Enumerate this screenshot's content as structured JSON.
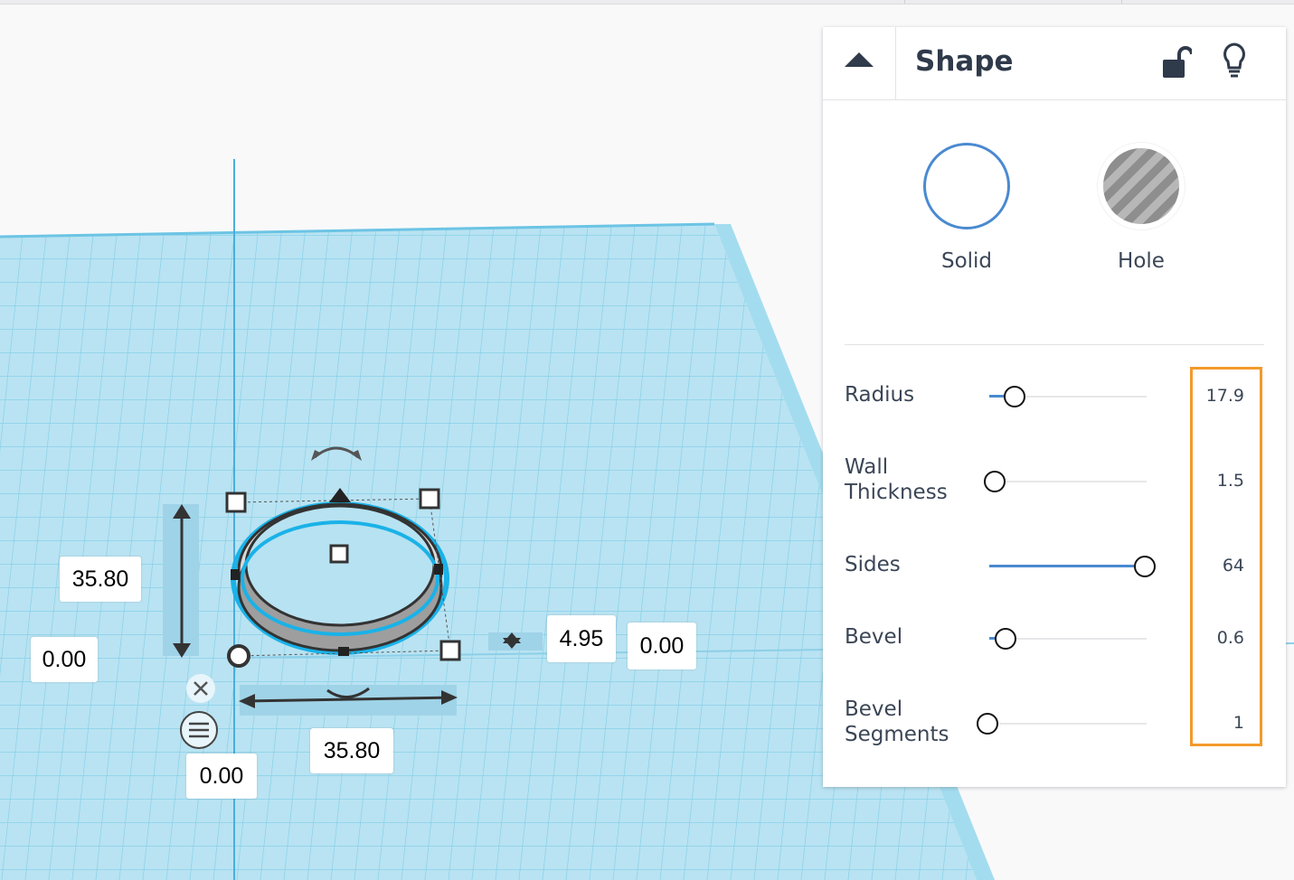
{
  "inspector": {
    "title": "Shape",
    "icons": [
      "collapse-up-icon",
      "lock-open-icon",
      "lightbulb-icon"
    ],
    "types": [
      {
        "label": "Solid",
        "selected": true
      },
      {
        "label": "Hole",
        "selected": false
      }
    ],
    "params": [
      {
        "label": "Radius",
        "value": "17.9",
        "slider_fraction": 0.18
      },
      {
        "label": "Wall\nThickness",
        "value": "1.5",
        "slider_fraction": 0.0
      },
      {
        "label": "Sides",
        "value": "64",
        "slider_fraction": 1.0
      },
      {
        "label": "Bevel",
        "value": "0.6",
        "slider_fraction": 0.12
      },
      {
        "label": "Bevel\nSegments",
        "value": "1",
        "slider_fraction": 0.0
      }
    ]
  },
  "dimensions": {
    "height": "35.80",
    "elevation": "0.00",
    "width": "35.80",
    "x_position": "0.00",
    "depth_length": "4.95",
    "offset": "0.00"
  },
  "colors": {
    "grid": "#7fcde8",
    "grid_background": "#b7e2f1",
    "accent": "#4a8ad0",
    "highlight": "#f39a2c",
    "ring_outline": "#1ab2e8"
  }
}
